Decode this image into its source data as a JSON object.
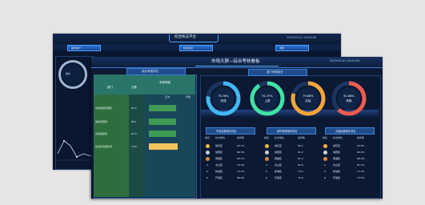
{
  "back_window": {
    "title": "综合执法平台",
    "datetime": "2019-09-01 00:00:00",
    "tabs": [
      "案件统计",
      "综合执法",
      "考核"
    ],
    "gauge_text": "统计"
  },
  "front_window": {
    "title": "市场大屏—综合考核看板",
    "datetime": "2019-09-01 00:00:00",
    "left_panel_title": "综合考核排名",
    "table": {
      "header_a": "部门",
      "header_b": "分数",
      "header_c": "考核明细",
      "header_d": "正常",
      "header_e": "异常",
      "rows": [
        {
          "label": "市场监督管理局",
          "value": "92.5"
        },
        {
          "label": "城市管理局",
          "value": "88.1"
        },
        {
          "label": "交通运输局",
          "value": "84.3"
        },
        {
          "label": "生态环境保护局",
          "value": "79.6"
        }
      ]
    },
    "right_panel_title": "部门考核统计",
    "gauges": [
      {
        "value_text": "76.78%",
        "label": "完成",
        "color": "#43b7f5"
      },
      {
        "value_text": "91.37%",
        "label": "上报",
        "color": "#41e0a5"
      },
      {
        "value_text": "79.68%",
        "label": "办结",
        "color": "#f2a53a"
      },
      {
        "value_text": "61.88%",
        "label": "考核",
        "color": "#ef5c4f"
      }
    ],
    "gauge_fractions": [
      0.77,
      0.91,
      0.8,
      0.62
    ],
    "rank_tables": [
      {
        "title": "市场监管案件排名",
        "columns": [
          "排名",
          "执法单位",
          "案件数"
        ],
        "rows": [
          [
            "1",
            "城东区",
            "95.7%"
          ],
          [
            "2",
            "城西区",
            "89.3%"
          ],
          [
            "3",
            "南湖区",
            "80.1%"
          ],
          [
            "4",
            "北山区",
            "76.4%"
          ],
          [
            "5",
            "新城区",
            "70.2%"
          ],
          [
            "6",
            "开发区",
            "68.9%"
          ]
        ]
      },
      {
        "title": "城市管理案件排名",
        "columns": [
          "排名",
          "执法单位",
          "案件数"
        ],
        "rows": [
          [
            "1",
            "城东区",
            "96.2"
          ],
          [
            "2",
            "城西区",
            "91.5"
          ],
          [
            "3",
            "南湖区",
            "87.3"
          ],
          [
            "4",
            "北山区",
            "82.6"
          ],
          [
            "5",
            "新城区",
            "79.4"
          ],
          [
            "6",
            "开发区",
            "75.8"
          ]
        ]
      },
      {
        "title": "交通运输案件排名",
        "columns": [
          "排名",
          "执法单位",
          "案件数"
        ],
        "rows": [
          [
            "1",
            "城东区",
            "94.8%"
          ],
          [
            "2",
            "城西区",
            "90.2%"
          ],
          [
            "3",
            "南湖区",
            "86.9%"
          ],
          [
            "4",
            "北山区",
            "81.1%"
          ],
          [
            "5",
            "新城区",
            "77.3%"
          ],
          [
            "6",
            "开发区",
            "72.5%"
          ]
        ]
      }
    ]
  },
  "colors": {
    "page_bg": "#e5e5e5",
    "dashboard_bg": "#0c1a34",
    "accent_blue": "#3d7fd6",
    "table_header_teal": "#2a7569",
    "bar_green": "#3f9a52",
    "bar_yellow": "#f2c35a"
  }
}
